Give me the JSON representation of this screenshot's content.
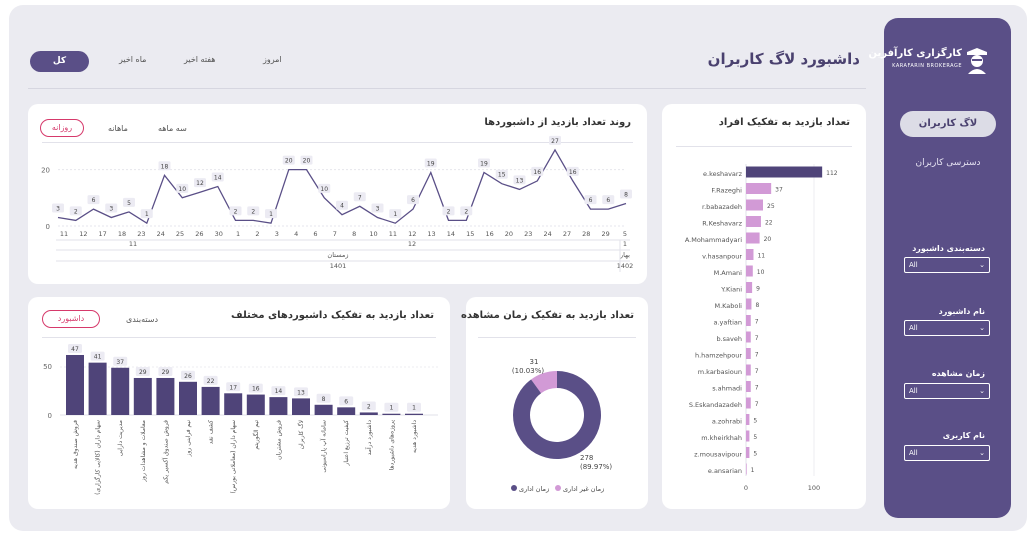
{
  "header": {
    "title": "داشبورد لاگ کاربران",
    "periods": [
      "امروز",
      "هفته اخیر",
      "ماه اخیر"
    ],
    "period_active": "کل"
  },
  "sidebar": {
    "logo_title": "کارگزاری کارآفرین",
    "logo_sub": "KARAFARIN BROKERAGE",
    "nav_active": "لاگ کاربران",
    "nav_item": "دسترسی کاربران",
    "filters": [
      {
        "label": "دسته‌بندی داشبورد",
        "value": "All"
      },
      {
        "label": "نام داشبورد",
        "value": "All"
      },
      {
        "label": "زمان مشاهده",
        "value": "All"
      },
      {
        "label": "نام کاربری",
        "value": "All"
      }
    ]
  },
  "trend": {
    "title": "روند تعداد بازدید از داشبوردها",
    "tabs": [
      "سه ماهه",
      "ماهانه"
    ],
    "tab_active": "روزانه",
    "y_ticks": [
      "20",
      "0"
    ],
    "days": [
      "11",
      "12",
      "17",
      "18",
      "23",
      "24",
      "25",
      "26",
      "30",
      "1",
      "2",
      "3",
      "4",
      "6",
      "7",
      "8",
      "10",
      "11",
      "12",
      "13",
      "14",
      "15",
      "16",
      "20",
      "23",
      "24",
      "27",
      "28",
      "29",
      "5"
    ],
    "months": [
      "11",
      "12",
      "1"
    ],
    "season_labels": [
      "زمستان",
      "بهار"
    ],
    "year_labels": [
      "1401",
      "1402"
    ]
  },
  "users": {
    "title": "تعداد بازدید به تفکیک افراد",
    "axis_ticks": [
      "0",
      "100"
    ]
  },
  "dash": {
    "title": "تعداد بازدید به تفکیک داشبوردهای مختلف",
    "tabs": [
      "دسته‌بندی"
    ],
    "tab_active": "داشبورد",
    "y_ticks": [
      "50",
      "0"
    ]
  },
  "donut": {
    "title": "تعداد بازدید به تفکیک زمان مشاهده",
    "label_small": "31",
    "label_small_pct": "(10.03%)",
    "label_big": "278",
    "label_big_pct": "(89.97%)",
    "legend": [
      "زمان اداری",
      "زمان غیر اداری"
    ]
  },
  "colors": {
    "accent": "#5a4f87",
    "pink": "#d6396b",
    "light_purple": "#d29ad6",
    "bar": "#4f4479"
  },
  "chart_data": [
    {
      "type": "line",
      "title": "روند تعداد بازدید از داشبوردها",
      "x": [
        "11",
        "12",
        "17",
        "18",
        "23",
        "24",
        "25",
        "26",
        "30",
        "1",
        "2",
        "3",
        "4",
        "6",
        "7",
        "8",
        "10",
        "11",
        "12",
        "13",
        "14",
        "15",
        "16",
        "20",
        "23",
        "24",
        "27",
        "28",
        "29",
        "5"
      ],
      "values": [
        3,
        2,
        6,
        3,
        5,
        1,
        18,
        10,
        12,
        14,
        2,
        2,
        1,
        20,
        20,
        10,
        4,
        7,
        3,
        1,
        6,
        19,
        2,
        2,
        19,
        15,
        13,
        16,
        27,
        16,
        6,
        6,
        8
      ],
      "ylim": [
        0,
        28
      ]
    },
    {
      "type": "bar",
      "title": "تعداد بازدید به تفکیک افراد",
      "categories": [
        "e.keshavarz",
        "F.Razeghi",
        "r.babazadeh",
        "R.Keshavarz",
        "A.Mohammadyari",
        "v.hasanpour",
        "M.Amani",
        "Y.Kiani",
        "M.Kaboli",
        "a.yaftian",
        "b.saveh",
        "h.hamzehpour",
        "m.karbasioun",
        "s.ahmadi",
        "S.Eskandazadeh",
        "a.zohrabi",
        "m.kheirkhah",
        "z.mousavipour",
        "e.ansarian"
      ],
      "values": [
        112,
        37,
        25,
        22,
        20,
        11,
        10,
        9,
        8,
        7,
        7,
        7,
        7,
        7,
        7,
        5,
        5,
        5,
        1
      ],
      "xlim": [
        0,
        125
      ]
    },
    {
      "type": "bar",
      "title": "تعداد بازدید به تفکیک داشبوردهای مختلف",
      "categories": [
        "فروش صندوق هدیه",
        "سهام داران (کالایی کارگزاری)",
        "مدیریت دارایی",
        "معاملات و مشاهدات روز",
        "فروش صندوق آکسیر یکم",
        "نیم فرابنی روز",
        "کشف نقد",
        "سهام داران (معاملاتی بورس)",
        "تیم الگوریتم",
        "فروش مشتریان",
        "لاگ کاربران",
        "سامانه آپ پاراسیونی",
        "کیفیت ترزیع اعتبار",
        "داشبورد درآمد",
        "پروژه‌های داشبورد‌ها",
        "داشبورد هدیه"
      ],
      "values": [
        47,
        41,
        37,
        29,
        29,
        26,
        22,
        17,
        16,
        14,
        13,
        8,
        6,
        2,
        1,
        1
      ],
      "ylim": [
        0,
        55
      ]
    },
    {
      "type": "pie",
      "title": "تعداد بازدید به تفکیک زمان مشاهده",
      "categories": [
        "زمان اداری",
        "زمان غیر اداری"
      ],
      "values": [
        278,
        31
      ]
    }
  ]
}
